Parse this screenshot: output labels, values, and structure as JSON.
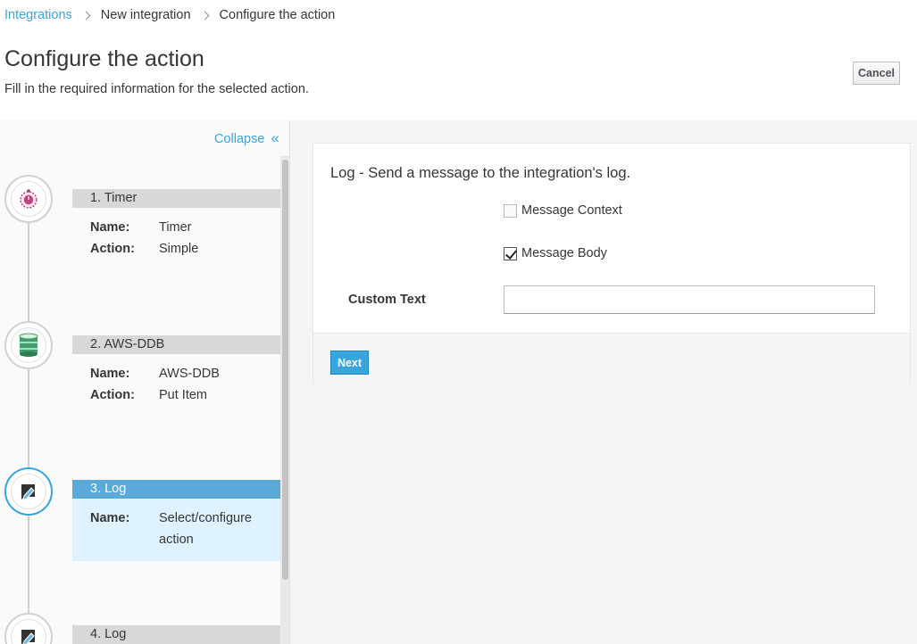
{
  "breadcrumb": {
    "items": [
      "Integrations",
      "New integration",
      "Configure the action"
    ]
  },
  "page": {
    "title": "Configure the action",
    "subtitle": "Fill in the required information for the selected action.",
    "cancel_label": "Cancel"
  },
  "sidebar": {
    "collapse_label": "Collapse",
    "collapse_icon": "double-chevron-left-icon",
    "steps": [
      {
        "header": "1. Timer",
        "icon": "timer-icon",
        "rows": [
          {
            "label": "Name:",
            "value": "Timer"
          },
          {
            "label": "Action:",
            "value": "Simple"
          }
        ]
      },
      {
        "header": "2. AWS-DDB",
        "icon": "database-icon",
        "rows": [
          {
            "label": "Name:",
            "value": "AWS-DDB"
          },
          {
            "label": "Action:",
            "value": "Put Item"
          }
        ]
      },
      {
        "header": "3. Log",
        "icon": "log-icon",
        "active": true,
        "rows": [
          {
            "label": "Name:",
            "value": "Select/configure action"
          }
        ]
      },
      {
        "header": "4. Log",
        "icon": "log-icon"
      }
    ]
  },
  "form": {
    "title": "Log - Send a message to the integration's log.",
    "message_context": {
      "label": "Message Context",
      "checked": false
    },
    "message_body": {
      "label": "Message Body",
      "checked": true
    },
    "custom_text": {
      "label": "Custom Text",
      "value": ""
    },
    "next_label": "Next"
  },
  "colors": {
    "accent": "#39a5dc",
    "active_header": "#5ba9d8",
    "active_body": "#def3ff",
    "inactive_header": "#d8d8d8"
  }
}
